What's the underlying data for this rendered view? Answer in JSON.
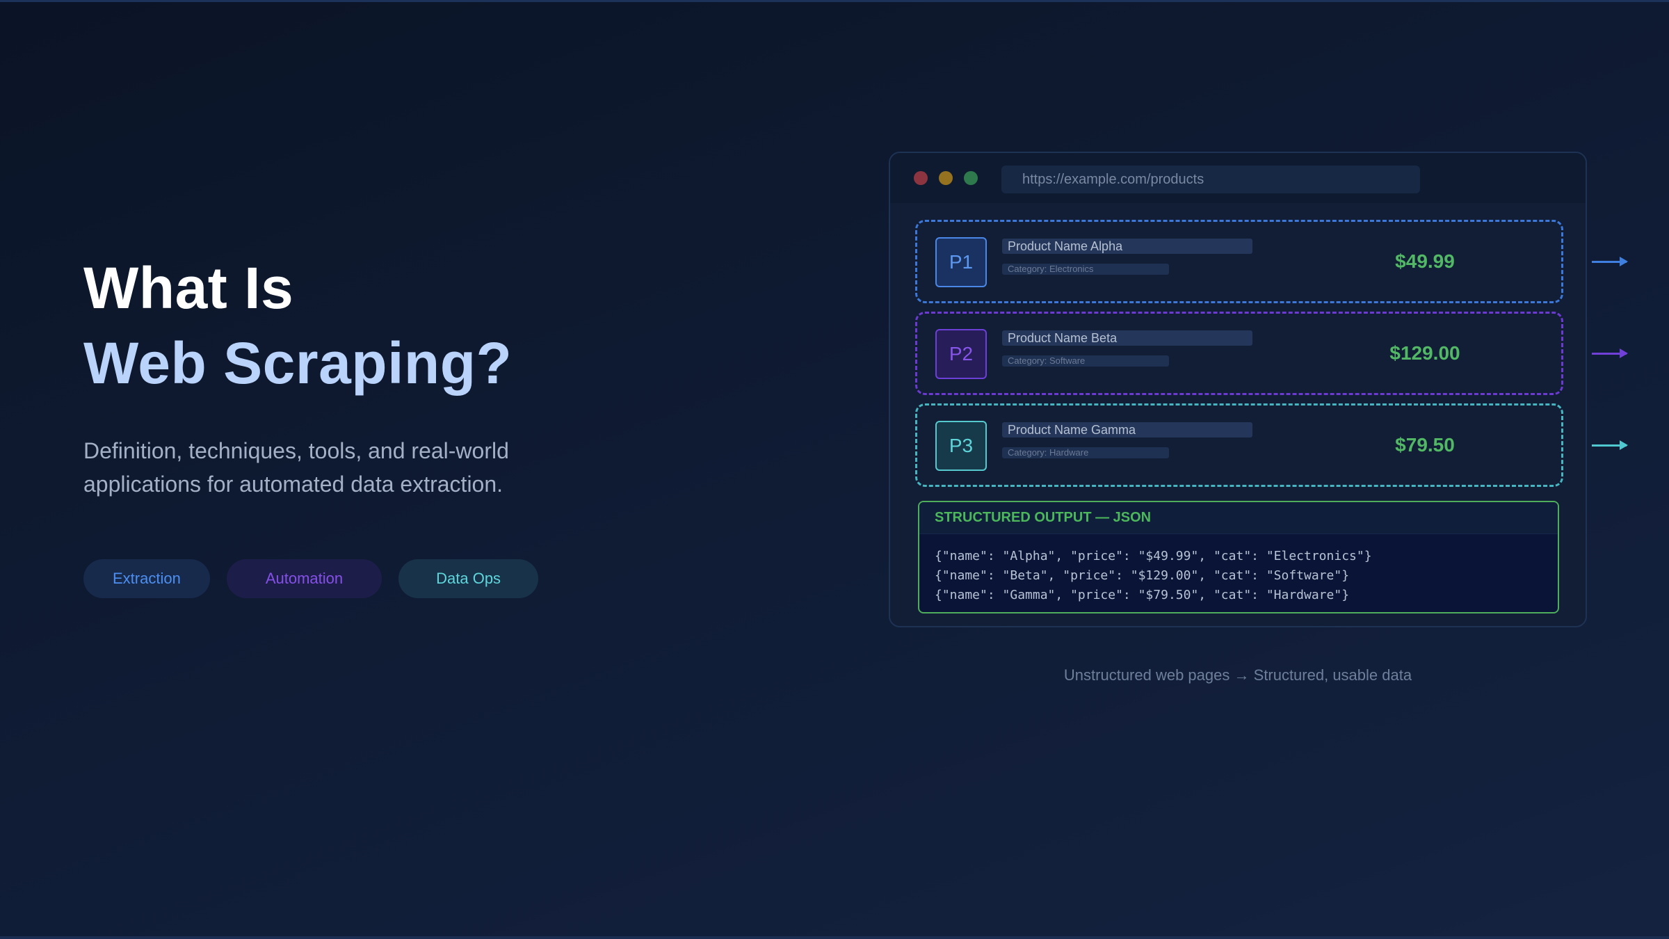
{
  "hero": {
    "title_line1": "What Is",
    "title_line2": "Web Scraping?",
    "description": "Definition, techniques, tools, and real-world applications for automated data extraction.",
    "tags": [
      "Extraction",
      "Automation",
      "Data Ops"
    ]
  },
  "browser": {
    "url": "https://example.com/products",
    "products": [
      {
        "badge": "P1",
        "name": "Product Name Alpha",
        "category": "Category: Electronics",
        "price": "$49.99"
      },
      {
        "badge": "P2",
        "name": "Product Name Beta",
        "category": "Category: Software",
        "price": "$129.00"
      },
      {
        "badge": "P3",
        "name": "Product Name Gamma",
        "category": "Category: Hardware",
        "price": "$79.50"
      }
    ],
    "output": {
      "title": "STRUCTURED OUTPUT — JSON",
      "lines": [
        "{\"name\": \"Alpha\", \"price\": \"$49.99\", \"cat\": \"Electronics\"}",
        "{\"name\": \"Beta\", \"price\": \"$129.00\", \"cat\": \"Software\"}",
        "{\"name\": \"Gamma\", \"price\": \"$79.50\", \"cat\": \"Hardware\"}"
      ]
    }
  },
  "caption": "Unstructured web pages → Structured, usable data",
  "colors": {
    "accent_blue": "#3d78d8",
    "accent_purple": "#6b3ad0",
    "accent_teal": "#47b5bf",
    "price_green": "#52b865"
  }
}
